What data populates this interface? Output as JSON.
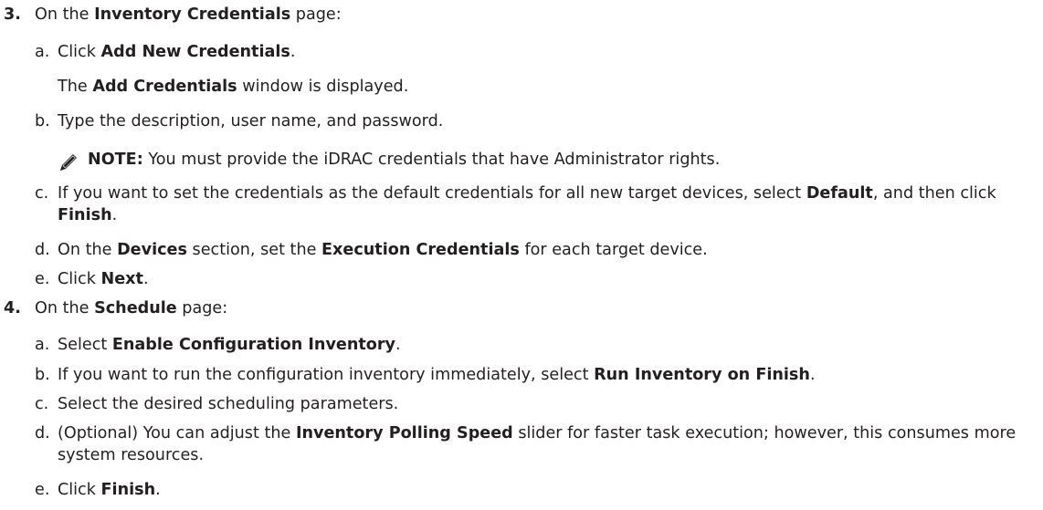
{
  "step3": {
    "number": "3.",
    "pre": "On the ",
    "bold": "Inventory Credentials",
    "post": " page:",
    "a": {
      "letter": "a.",
      "pre": "Click ",
      "bold": "Add New Credentials",
      "post": ".",
      "para_pre": "The ",
      "para_bold": "Add Credentials",
      "para_post": " window is displayed."
    },
    "b": {
      "letter": "b.",
      "text": "Type the description, user name, and password."
    },
    "note": {
      "icon": "pencil-icon",
      "label": "NOTE:",
      "text": " You must provide the iDRAC credentials that have Administrator rights."
    },
    "c": {
      "letter": "c.",
      "pre": "If you want to set the credentials as the default credentials for all new target devices, select ",
      "bold1": "Default",
      "mid": ", and then click ",
      "bold2": "Finish",
      "post": "."
    },
    "d": {
      "letter": "d.",
      "pre": "On the ",
      "bold1": "Devices",
      "mid": " section, set the ",
      "bold2": "Execution Credentials",
      "post": " for each target device."
    },
    "e": {
      "letter": "e.",
      "pre": "Click ",
      "bold": "Next",
      "post": "."
    }
  },
  "step4": {
    "number": "4.",
    "pre": "On the ",
    "bold": "Schedule",
    "post": " page:",
    "a": {
      "letter": "a.",
      "pre": "Select ",
      "bold": "Enable Configuration Inventory",
      "post": "."
    },
    "b": {
      "letter": "b.",
      "pre": "If you want to run the configuration inventory immediately, select ",
      "bold": "Run Inventory on Finish",
      "post": "."
    },
    "c": {
      "letter": "c.",
      "text": "Select the desired scheduling parameters."
    },
    "d": {
      "letter": "d.",
      "pre": "(Optional) You can adjust the ",
      "bold": "Inventory Polling Speed",
      "post": " slider for faster task execution; however, this consumes more system resources."
    },
    "e": {
      "letter": "e.",
      "pre": "Click ",
      "bold": "Finish",
      "post": "."
    }
  }
}
